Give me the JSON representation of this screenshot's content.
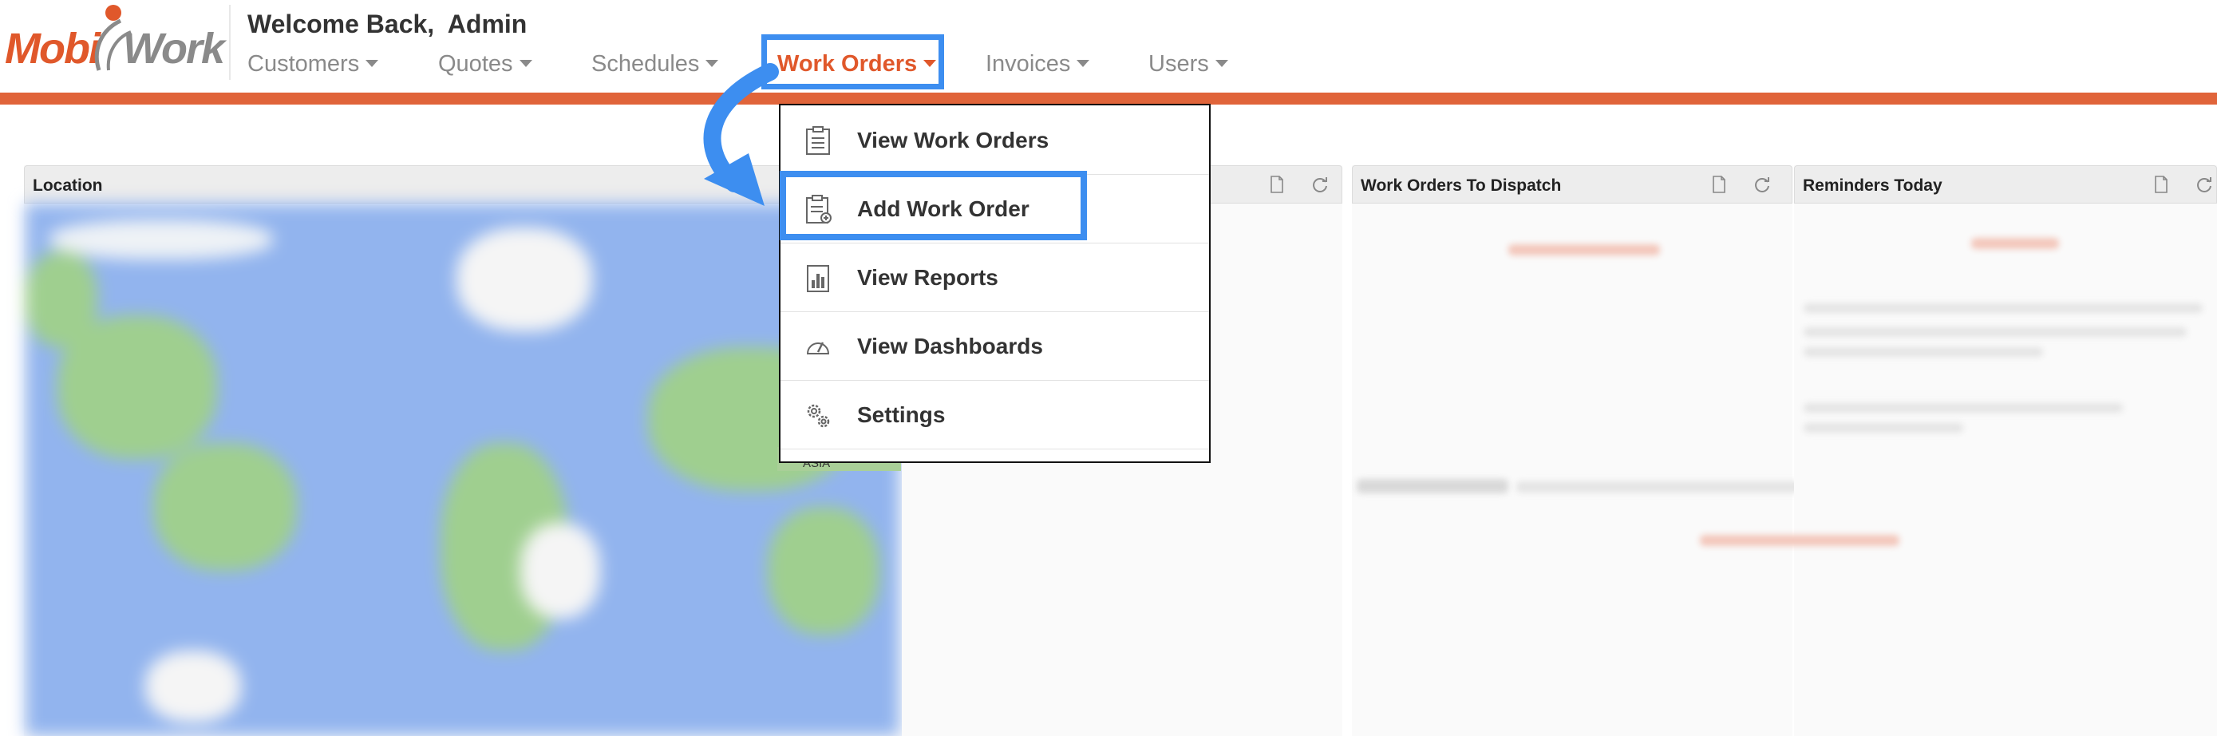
{
  "header": {
    "logo_left": "Mobi",
    "logo_right": "Work",
    "welcome": "Welcome Back,  Admin"
  },
  "nav": {
    "items": [
      {
        "label": "Customers"
      },
      {
        "label": "Quotes"
      },
      {
        "label": "Schedules"
      },
      {
        "label": "Work Orders",
        "active": true
      },
      {
        "label": "Invoices"
      },
      {
        "label": "Users"
      }
    ]
  },
  "dropdown": {
    "items": [
      {
        "label": "View Work Orders",
        "icon": "clipboard-icon"
      },
      {
        "label": "Add Work Order",
        "icon": "clipboard-add-icon"
      },
      {
        "label": "View Reports",
        "icon": "bar-chart-icon"
      },
      {
        "label": "View Dashboards",
        "icon": "gauge-icon"
      },
      {
        "label": "Settings",
        "icon": "gears-icon"
      }
    ]
  },
  "panels": {
    "location": {
      "title": "Location",
      "map_label": "ASIA"
    },
    "dispatch": {
      "title": "Work Orders To Dispatch"
    },
    "reminders": {
      "title": "Reminders Today"
    }
  },
  "colors": {
    "brand_orange": "#e0582b",
    "highlight_blue": "#3d8ef0",
    "nav_grey": "#8a8a8a"
  }
}
